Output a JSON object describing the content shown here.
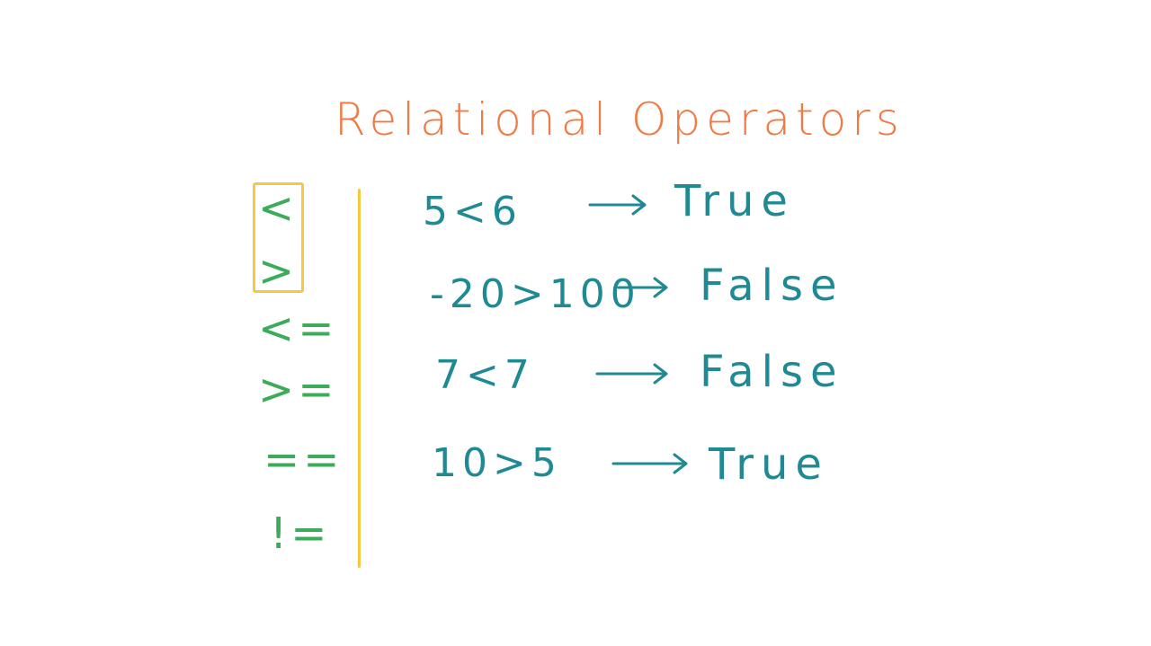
{
  "title": "Relational Operators",
  "operators": [
    "<",
    ">",
    "<=",
    ">=",
    "==",
    "!="
  ],
  "examples": [
    {
      "expression": "5<6",
      "result": "True"
    },
    {
      "expression": "-20>100",
      "result": "False"
    },
    {
      "expression": "7<7",
      "result": "False"
    },
    {
      "expression": "10>5",
      "result": "True"
    }
  ],
  "colors": {
    "title": "#f07a43",
    "operators": "#3cab5a",
    "highlight": "#f5c842",
    "examples": "#1f8a94"
  }
}
